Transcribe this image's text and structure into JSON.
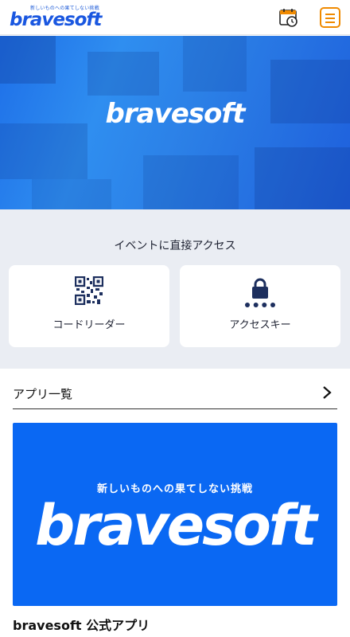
{
  "header": {
    "logo_tagline": "新しいものへの果てしない挑戦",
    "logo_text": "bravesoft",
    "history_icon": "calendar-clock-icon",
    "menu_icon": "hamburger-menu-icon",
    "accent_color": "#f08a00"
  },
  "hero": {
    "logo_text": "bravesoft",
    "background_color": "#2a7fe8"
  },
  "access": {
    "title": "イベントに直接アクセス",
    "cards": [
      {
        "label": "コードリーダー",
        "icon": "qr-code-icon"
      },
      {
        "label": "アクセスキー",
        "icon": "lock-icon"
      }
    ]
  },
  "app_list": {
    "title": "アプリ一覧",
    "chevron_icon": "chevron-right-icon",
    "apps": [
      {
        "banner_tagline": "新しいものへの果てしない挑戦",
        "banner_logo": "bravesoft",
        "name": "bravesoft 公式アプリ",
        "banner_color": "#0a68f3"
      }
    ]
  }
}
